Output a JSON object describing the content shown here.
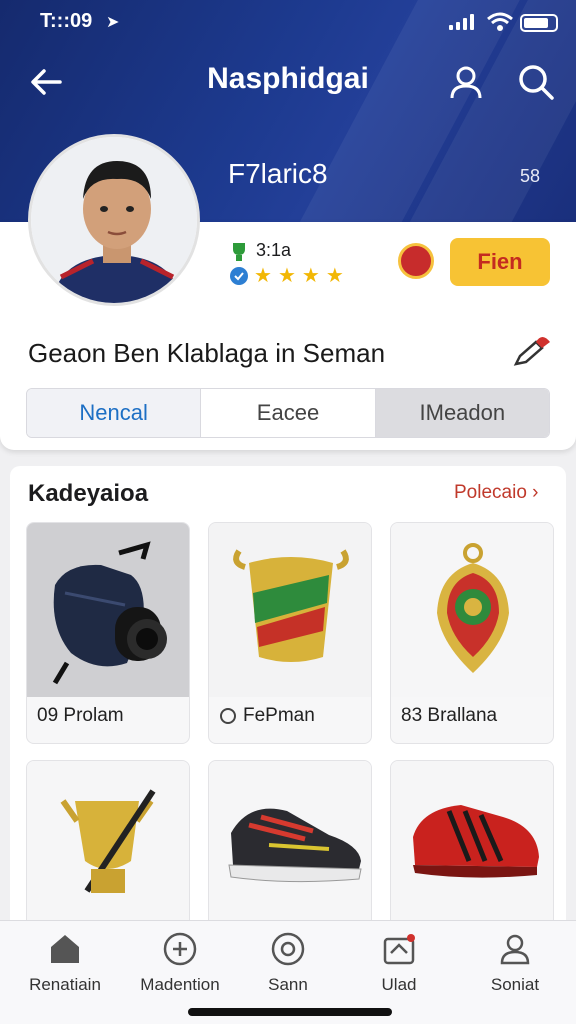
{
  "status_bar": {
    "time": "T:::09",
    "icons": [
      "location-arrow-icon",
      "signal-icon",
      "wifi-icon",
      "battery-icon"
    ]
  },
  "header": {
    "title": "Nasphidgai",
    "back_icon": "arrow-left-icon",
    "user_icon": "user-icon",
    "search_icon": "search-icon"
  },
  "profile": {
    "username": "F7laric8",
    "stat": "58",
    "level": "3:1a",
    "rating_stars": 4,
    "follow_label": "Fien",
    "bio": "Geaon Ben Klablaga in Seman",
    "edit_icon": "edit-icon"
  },
  "segments": [
    "Nencal",
    "Eacee",
    "IMeadon"
  ],
  "section": {
    "title": "Kadeyaioa",
    "link": "Polecaio ›"
  },
  "items": [
    {
      "label": "09 Prolam",
      "icon": "backpack-camera"
    },
    {
      "label": "FePman",
      "icon": "gold-cup"
    },
    {
      "label": "83 Brallana",
      "icon": "medal-pendant"
    },
    {
      "label": "",
      "icon": "gold-trophy"
    },
    {
      "label": "",
      "icon": "sneaker"
    },
    {
      "label": "",
      "icon": "red-shoe"
    }
  ],
  "bottom_nav": [
    {
      "label": "Renatiain",
      "icon": "home-icon"
    },
    {
      "label": "Madention",
      "icon": "plus-circle-icon"
    },
    {
      "label": "Sann",
      "icon": "circle-dot-icon"
    },
    {
      "label": "Ulad",
      "icon": "camera-icon"
    },
    {
      "label": "Soniat",
      "icon": "profile-icon"
    }
  ],
  "colors": {
    "header": "#1d3a8f",
    "accent": "#f7c334",
    "link": "#c0392b",
    "active_segment": "#1d6fc4"
  }
}
